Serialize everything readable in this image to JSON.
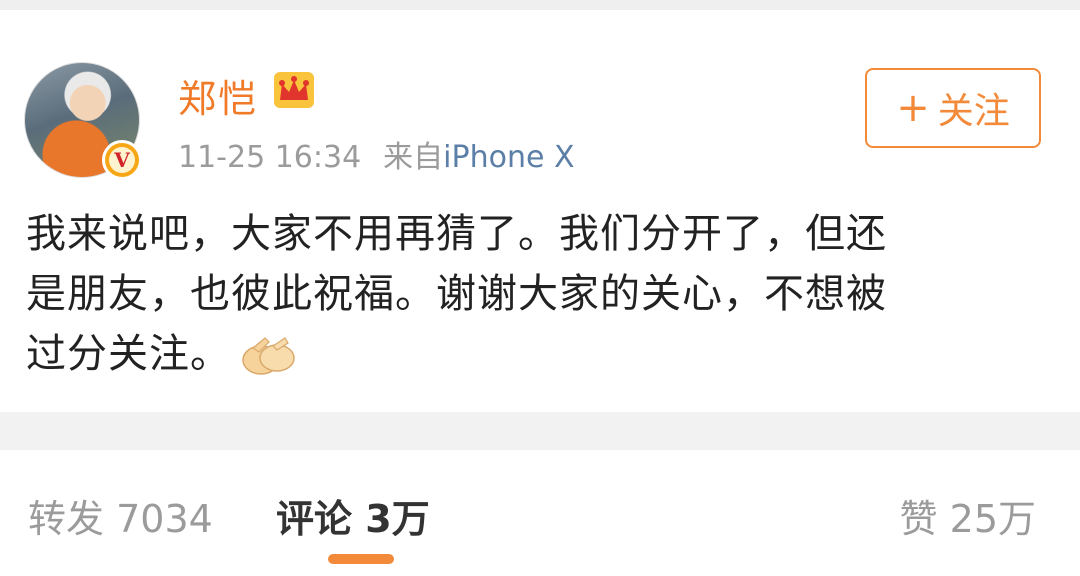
{
  "post": {
    "username": "郑恺",
    "time": "11-25 16:34",
    "source_prefix": "来自",
    "source_device": "iPhone X",
    "follow_label": "关注",
    "text_line1": "我来说吧，大家不用再猜了。我们分开了，但还",
    "text_line2": "是朋友，也彼此祝福。谢谢大家的关心，不想被",
    "text_line3": "过分关注。",
    "icons": [
      "avatar",
      "verified-badge-icon",
      "crown-icon",
      "plus-icon",
      "ok-hand-emoji-icon"
    ]
  },
  "actions": {
    "repost_label": "转发",
    "repost_count": "7034",
    "comment_label": "评论",
    "comment_count": "3万",
    "like_label": "赞",
    "like_count": "25万",
    "active_tab": "comment"
  },
  "colors": {
    "accent": "#f28a3a",
    "username": "#f07a27",
    "link": "#5b7fa6",
    "muted": "#9b9b9b"
  }
}
